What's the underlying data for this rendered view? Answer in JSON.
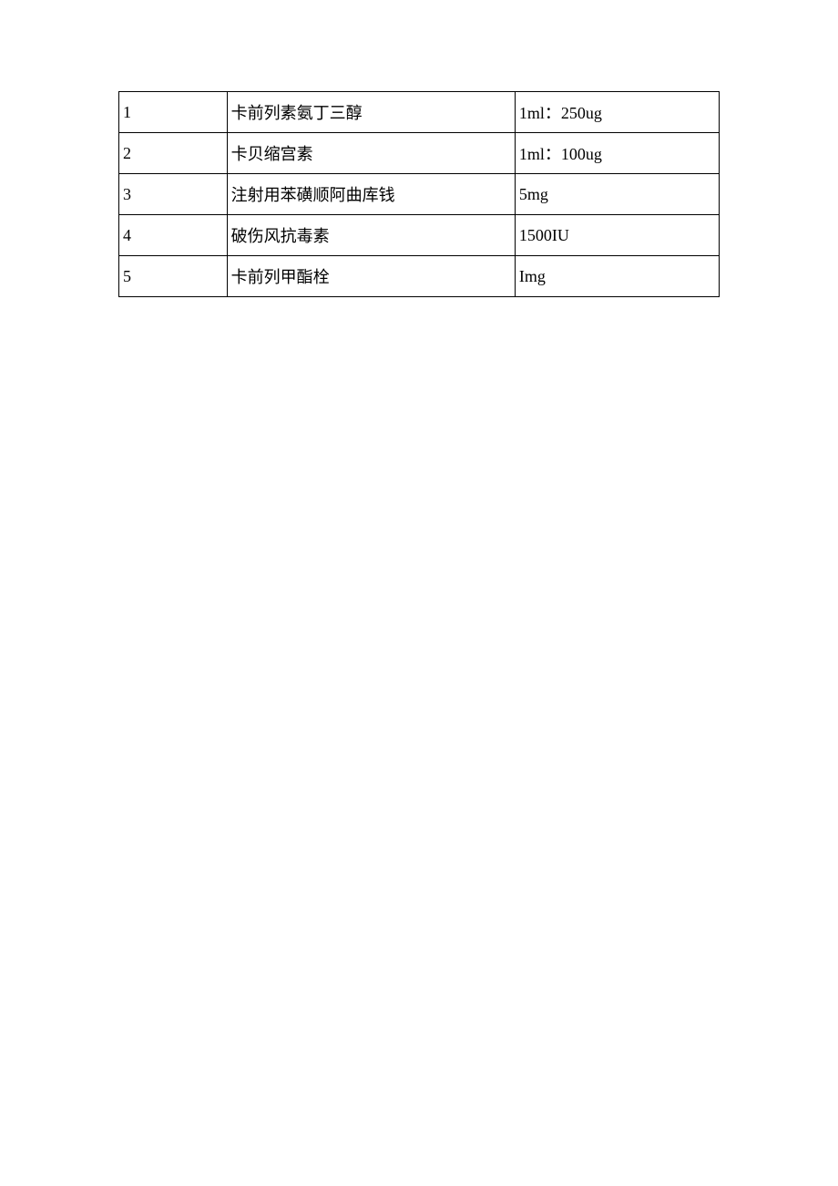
{
  "table": {
    "rows": [
      {
        "idx": "1",
        "name": "卡前列素氨丁三醇",
        "spec": "1ml：250ug"
      },
      {
        "idx": "2",
        "name": "卡贝缩宫素",
        "spec": "1ml：100ug"
      },
      {
        "idx": "3",
        "name": "注射用苯磺顺阿曲库钱",
        "spec": "5mg"
      },
      {
        "idx": "4",
        "name": "破伤风抗毒素",
        "spec": "1500IU"
      },
      {
        "idx": "5",
        "name": "卡前列甲酯栓",
        "spec": "Img"
      }
    ]
  }
}
